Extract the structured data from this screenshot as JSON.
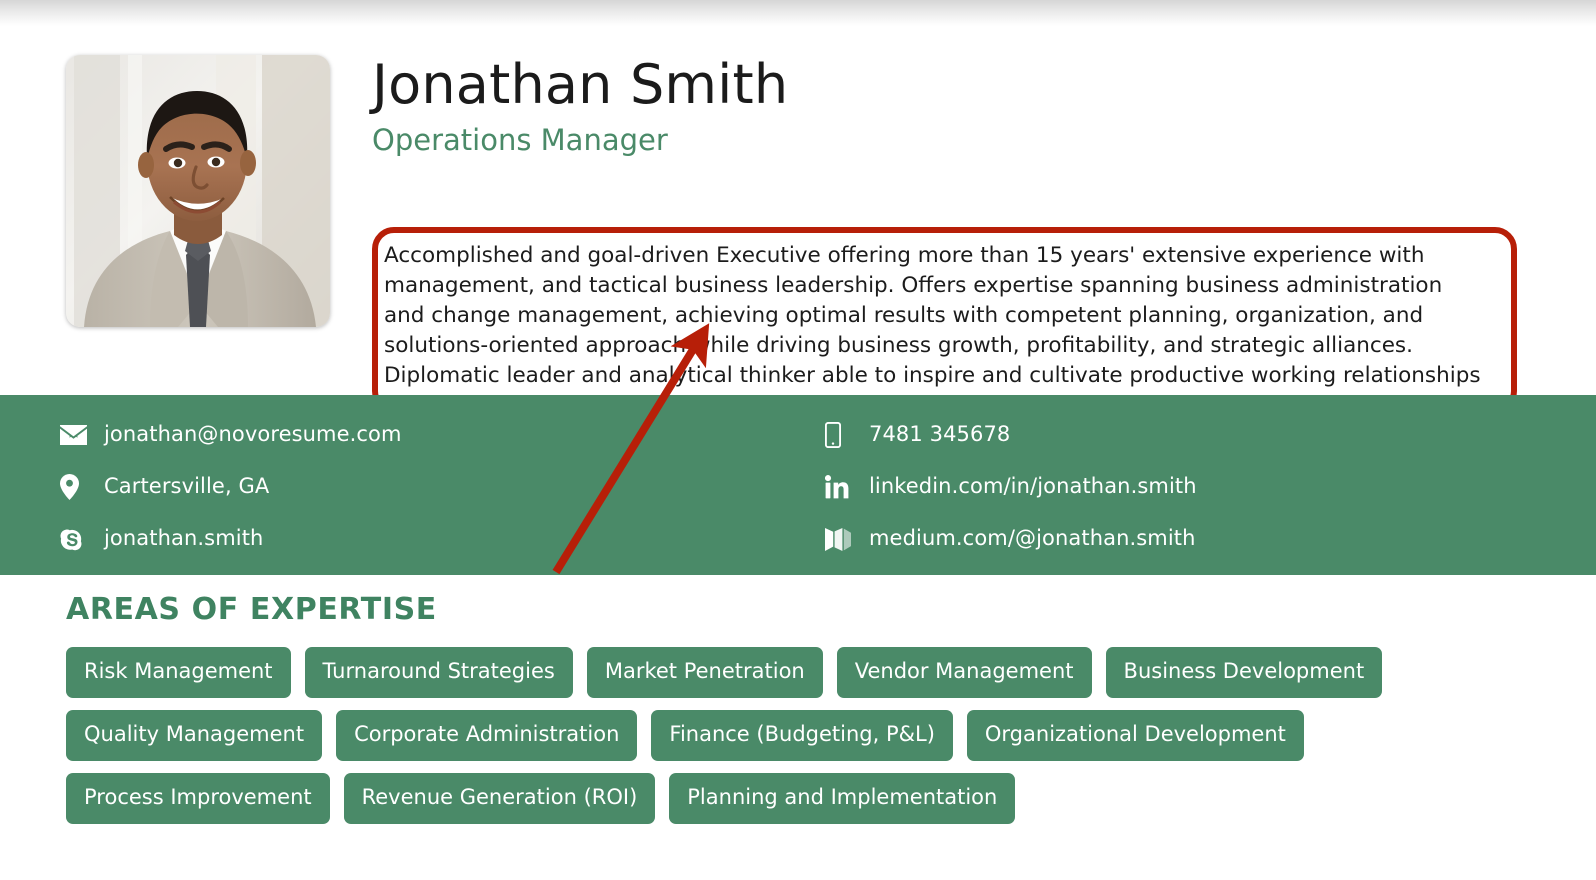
{
  "document": {
    "type": "resume-preview",
    "colors": {
      "accent_green": "#4a8a68",
      "title_green": "#3f8361",
      "annotation_red": "#b71f08",
      "text_dark": "#1c1c1c"
    }
  },
  "header": {
    "name": "Jonathan Smith",
    "job_title": "Operations Manager",
    "photo_alt": "Headshot of a smiling man in a light gray suit with white shirt and dark patterned tie",
    "summary": "Accomplished and goal-driven Executive offering more than 15 years' extensive experience with management, and tactical business leadership. Offers expertise spanning business administration and change management, achieving optimal results with competent planning, organization, and solutions-oriented approach while driving business growth, profitability, and strategic alliances. Diplomatic leader and analytical thinker able to inspire and cultivate productive working relationships with employees and partners."
  },
  "annotation": {
    "shape": "arrow",
    "color": "#b71f08",
    "points_to": "summary-text-box",
    "highlight_box_target": "resume-summary"
  },
  "contact": {
    "left_column": [
      {
        "icon": "envelope-icon",
        "label": "jonathan@novoresume.com"
      },
      {
        "icon": "map-pin-icon",
        "label": "Cartersville, GA"
      },
      {
        "icon": "skype-icon",
        "label": "jonathan.smith"
      }
    ],
    "right_column": [
      {
        "icon": "mobile-phone-icon",
        "label": "7481 345678"
      },
      {
        "icon": "linkedin-icon",
        "label": "linkedin.com/in/jonathan.smith"
      },
      {
        "icon": "medium-icon",
        "label": "medium.com/@jonathan.smith"
      }
    ]
  },
  "expertise": {
    "title": "AREAS OF EXPERTISE",
    "rows": [
      [
        "Risk Management",
        "Turnaround Strategies",
        "Market Penetration",
        "Vendor Management",
        "Business Development"
      ],
      [
        "Quality Management",
        "Corporate Administration",
        "Finance (Budgeting, P&L)",
        "Organizational Development"
      ],
      [
        "Process Improvement",
        "Revenue Generation (ROI)",
        "Planning and Implementation"
      ]
    ]
  }
}
